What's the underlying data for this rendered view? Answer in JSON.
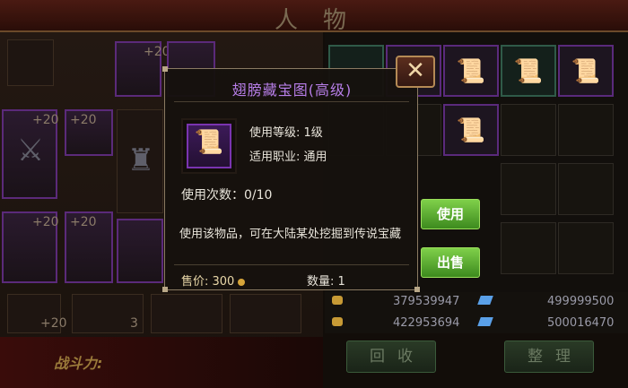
{
  "window": {
    "title": "人物",
    "close_glyph": "✕"
  },
  "equipment": {
    "plus_labels": [
      "+20",
      "+20",
      "+20",
      "+20",
      "+20"
    ],
    "bottom_counts": [
      "+20",
      "3"
    ],
    "combat_power_label": "战斗力:"
  },
  "tooltip": {
    "title": "翅膀藏宝图(高级)",
    "level_req": "使用等级: 1级",
    "job_req": "适用职业: 通用",
    "uses": "使用次数：0/10",
    "description": "使用该物品，可在大陆某处挖掘到传说宝藏",
    "price_label": "售价: 300",
    "quantity_label": "数量: 1"
  },
  "actions": {
    "use": "使用",
    "sell": "出售",
    "recycle": "回收",
    "arrange": "整理"
  },
  "currency": {
    "gold_1": "379539947",
    "diamond_1": "499999500",
    "gold_2": "422953694",
    "diamond_2": "500016470"
  },
  "icons": [
    "close-icon",
    "scroll-icon",
    "coin-icon",
    "diamond-icon",
    "gold-ingot-icon"
  ],
  "colors": {
    "item_rarity": "#b77ee8",
    "button_green": "#5aae2e",
    "rarity_border": "#7a34b0"
  }
}
